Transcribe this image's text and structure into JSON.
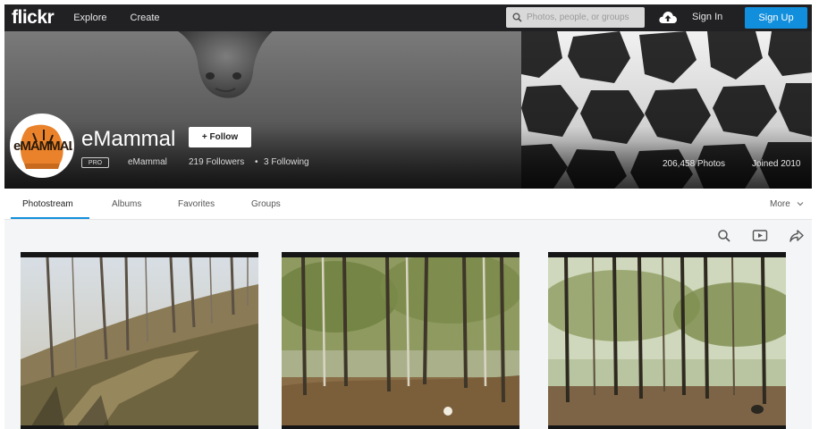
{
  "nav": {
    "logo": "flickr",
    "links": [
      "Explore",
      "Create"
    ],
    "search_placeholder": "Photos, people, or groups",
    "signin": "Sign In",
    "signup": "Sign Up"
  },
  "profile": {
    "name": "eMammal",
    "avatar_text": "eMAMMAL",
    "follow_label": "+ Follow",
    "pro_badge": "PRO",
    "username": "eMammal",
    "followers": "219 Followers",
    "separator": "•",
    "following": "3 Following",
    "photos": "206,458 Photos",
    "joined": "Joined 2010"
  },
  "tabs": [
    "Photostream",
    "Albums",
    "Favorites",
    "Groups"
  ],
  "more_label": "More",
  "colors": {
    "nav_bg": "#212124",
    "accent": "#128fdc"
  },
  "icons": [
    "search-icon",
    "upload-icon",
    "slideshow-icon",
    "share-icon",
    "chevron-down-icon"
  ]
}
